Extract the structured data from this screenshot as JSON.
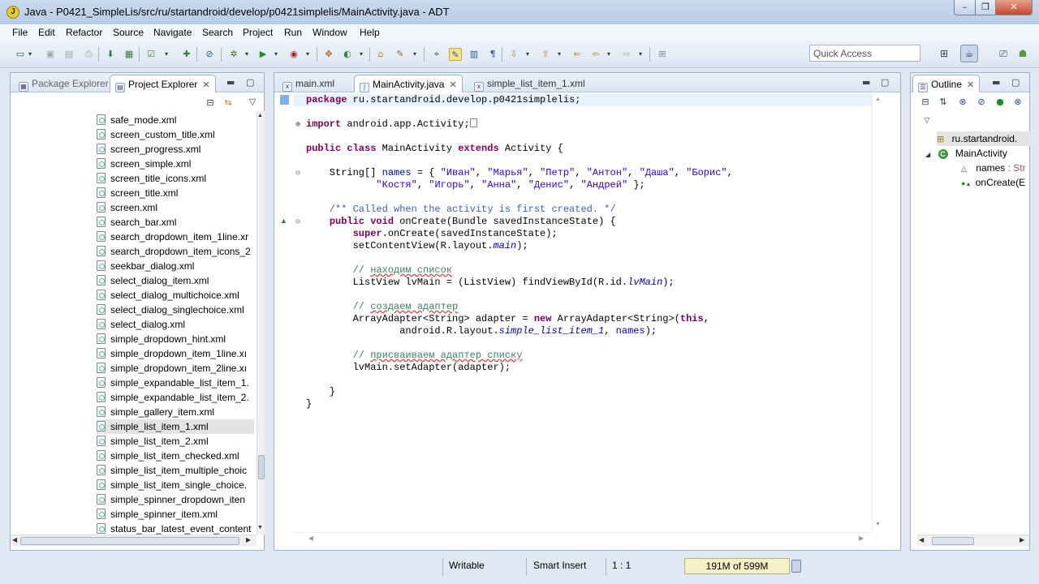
{
  "window": {
    "icon_letter": "J",
    "title": "Java - P0421_SimpleLis/src/ru/startandroid/develop/p0421simplelis/MainActivity.java - ADT",
    "min": "–",
    "max": "❐",
    "close": "✕"
  },
  "menu": [
    "File",
    "Edit",
    "Refactor",
    "Source",
    "Navigate",
    "Search",
    "Project",
    "Run",
    "Window",
    "Help"
  ],
  "toolbar": {
    "quick_access_placeholder": "Quick Access"
  },
  "explorer": {
    "tabs": [
      {
        "label": "Package Explorer",
        "active": false
      },
      {
        "label": "Project Explorer",
        "active": true
      }
    ],
    "files": [
      "safe_mode.xml",
      "screen_custom_title.xml",
      "screen_progress.xml",
      "screen_simple.xml",
      "screen_title_icons.xml",
      "screen_title.xml",
      "screen.xml",
      "search_bar.xml",
      "search_dropdown_item_1line.xr",
      "search_dropdown_item_icons_2",
      "seekbar_dialog.xml",
      "select_dialog_item.xml",
      "select_dialog_multichoice.xml",
      "select_dialog_singlechoice.xml",
      "select_dialog.xml",
      "simple_dropdown_hint.xml",
      "simple_dropdown_item_1line.xı",
      "simple_dropdown_item_2line.xı",
      "simple_expandable_list_item_1.",
      "simple_expandable_list_item_2.",
      "simple_gallery_item.xml",
      "simple_list_item_1.xml",
      "simple_list_item_2.xml",
      "simple_list_item_checked.xml",
      "simple_list_item_multiple_choic",
      "simple_list_item_single_choice.",
      "simple_spinner_dropdown_iten",
      "simple_spinner_item.xml",
      "status_bar_latest_event_content"
    ],
    "selected_index": 21
  },
  "editor": {
    "tabs": [
      {
        "label": "main.xml",
        "active": false
      },
      {
        "label": "MainActivity.java",
        "active": true
      },
      {
        "label": "simple_list_item_1.xml",
        "active": false
      }
    ],
    "code": {
      "l1_kw": "package",
      "l1_rest": " ru.startandroid.develop.p0421simplelis;",
      "l2_kw": "import",
      "l2_rest": " android.app.Activity;",
      "l3_kw1": "public class",
      "l3_name": " MainActivity ",
      "l3_kw2": "extends",
      "l3_rest": " Activity {",
      "l4_a": "    String[] ",
      "l4_fld": "names",
      "l4_b": " = { ",
      "l4_s": [
        "\"Иван\"",
        "\"Марья\"",
        "\"Петр\"",
        "\"Антон\"",
        "\"Даша\"",
        "\"Борис\""
      ],
      "l5_s": [
        "\"Костя\"",
        "\"Игорь\"",
        "\"Анна\"",
        "\"Денис\"",
        "\"Андрей\""
      ],
      "l5_end": " };",
      "doc": "    /** Called when the activity is first created. */",
      "l7_kw": "public void",
      "l7_rest": " onCreate(Bundle savedInstanceState) {",
      "l8_kw": "super",
      "l8_rest": ".onCreate(savedInstanceState);",
      "l9_a": "        setContentView(R.layout.",
      "l9_it": "main",
      "l9_b": ");",
      "c1_slash": "        // ",
      "c1_text": "находим список",
      "l11_a": "        ListView lvMain = (ListView) findViewById(R.id.",
      "l11_it": "lvMain",
      "l11_b": ");",
      "c2_slash": "        // ",
      "c2_text": "создаем адаптер",
      "l13_a": "        ArrayAdapter<String> adapter = ",
      "l13_kw1": "new",
      "l13_b": " ArrayAdapter<String>(",
      "l13_kw2": "this",
      "l13_c": ",",
      "l14_a": "                android.R.layout.",
      "l14_it": "simple_list_item_1",
      "l14_b": ", ",
      "l14_fld": "names",
      "l14_c": ");",
      "c3_slash": "        // ",
      "c3_text": "присваиваем адаптер списку",
      "l16": "        lvMain.setAdapter(adapter);",
      "l17": "    }",
      "l18": "}"
    }
  },
  "outline": {
    "tab": "Outline",
    "items": [
      {
        "label": "ru.startandroid."
      },
      {
        "label": "MainActivity"
      },
      {
        "label": "names",
        "type": " : Str"
      },
      {
        "label": "onCreate(E"
      }
    ]
  },
  "status": {
    "writable": "Writable",
    "insert_mode": "Smart Insert",
    "position": "1 : 1",
    "heap": "191M of 599M"
  }
}
